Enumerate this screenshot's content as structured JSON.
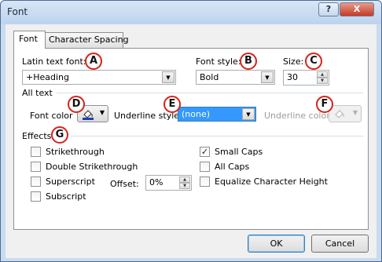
{
  "window": {
    "title": "Font",
    "help": "?",
    "close": "X"
  },
  "tabs": [
    {
      "label": "Font",
      "active": true
    },
    {
      "label": "Character Spacing",
      "active": false
    }
  ],
  "latin_font": {
    "label": "Latin text font:",
    "value": "+Heading"
  },
  "font_style": {
    "label": "Font style:",
    "value": "Bold"
  },
  "size": {
    "label": "Size:",
    "value": "30"
  },
  "all_text": {
    "heading": "All text",
    "font_color_label": "Font color",
    "underline_style_label": "Underline style",
    "underline_style_value": "(none)",
    "underline_color_label": "Underline color"
  },
  "effects": {
    "heading": "Effects",
    "checkboxes": [
      {
        "label": "Strikethrough",
        "checked": false
      },
      {
        "label": "Double Strikethrough",
        "checked": false
      },
      {
        "label": "Superscript",
        "checked": false
      },
      {
        "label": "Subscript",
        "checked": false
      },
      {
        "label": "Small Caps",
        "checked": true
      },
      {
        "label": "All Caps",
        "checked": false
      },
      {
        "label": "Equalize Character Height",
        "checked": false
      }
    ],
    "offset_label": "Offset:",
    "offset_value": "0%"
  },
  "callouts": [
    "A",
    "B",
    "C",
    "D",
    "E",
    "F",
    "G"
  ],
  "buttons": {
    "ok": "OK",
    "cancel": "Cancel"
  },
  "colors": {
    "callout_ring": "#d6221a",
    "selection": "#3399ff",
    "title_bar": "#c9dbef"
  }
}
